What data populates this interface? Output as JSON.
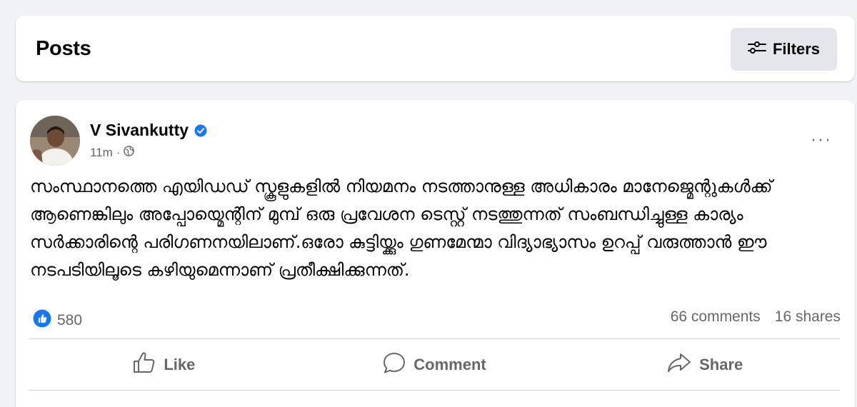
{
  "header": {
    "title": "Posts",
    "filters_label": "Filters",
    "filters_icon": "sliders-icon"
  },
  "post": {
    "author": "V Sivankutty",
    "verified_icon": "verified-badge-icon",
    "time": "11m",
    "separator": "·",
    "privacy_icon": "globe-icon",
    "more_label": "···",
    "text": "സംസ്ഥാനത്തെ എയിഡഡ് സ്കൂളുകളിൽ നിയമനം നടത്താനുള്ള അധികാരം മാനേജ്മെന്റുകൾക്ക് ആണെങ്കിലും അപ്പോയ്മെന്റിന് മുമ്പ് ഒരു പ്രവേശന ടെസ്റ്റ് നടത്തുന്നത് സംബന്ധിച്ചുള്ള കാര്യം സർക്കാരിന്റെ പരിഗണനയിലാണ്.ഒരോ കുട്ടിയ്ക്കും ഗുണമേന്മാ വിദ്യാഭ്യാസം ഉറപ്പ് വരുത്താൻ ഈ നടപടിയിലൂടെ കഴിയുമെന്നാണ് പ്രതീക്ഷിക്കുന്നത്.",
    "reaction_icon": "like-reaction-icon",
    "reaction_count": "580",
    "comments": "66 comments",
    "shares": "16 shares"
  },
  "actions": {
    "like": "Like",
    "comment": "Comment",
    "share": "Share"
  },
  "colors": {
    "page_bg": "#f0f2f5",
    "card_bg": "#ffffff",
    "accent": "#1877f2",
    "muted_text": "#65676b",
    "button_bg": "#e4e6eb"
  }
}
